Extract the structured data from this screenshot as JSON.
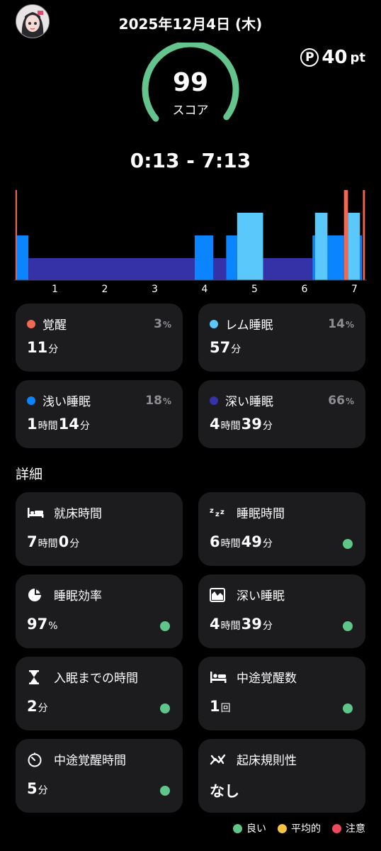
{
  "header": {
    "date": "2025年12月4日 (木)"
  },
  "points": {
    "badge": "P",
    "value": "40",
    "unit": "pt"
  },
  "score": {
    "value": "99",
    "label": "スコア",
    "fraction": 0.99
  },
  "sleep_window": "0:13 - 7:13",
  "colors": {
    "awake": "#ef6a55",
    "rem": "#5ac8fa",
    "light": "#0a84ff",
    "deep": "#3532a7",
    "good": "#5fc68a",
    "avg": "#f6c344",
    "warn": "#ef4a5a",
    "gauge": "#63c48e"
  },
  "hypnogram": {
    "hour_ticks": [
      "1",
      "2",
      "3",
      "4",
      "5",
      "6",
      "7"
    ]
  },
  "chart_data": {
    "type": "area",
    "x_unit": "clock hour",
    "x_ticks": [
      1,
      2,
      3,
      4,
      5,
      6,
      7
    ],
    "levels": [
      "deep",
      "light",
      "rem",
      "awake"
    ],
    "segments": [
      {
        "stage": "awake",
        "start": 0.21,
        "end": 0.24
      },
      {
        "stage": "light",
        "start": 0.24,
        "end": 0.47
      },
      {
        "stage": "deep",
        "start": 0.47,
        "end": 3.8
      },
      {
        "stage": "light",
        "start": 3.8,
        "end": 4.17
      },
      {
        "stage": "deep",
        "start": 4.17,
        "end": 4.43
      },
      {
        "stage": "light",
        "start": 4.43,
        "end": 4.65
      },
      {
        "stage": "rem",
        "start": 4.65,
        "end": 5.17
      },
      {
        "stage": "deep",
        "start": 5.17,
        "end": 6.16
      },
      {
        "stage": "light",
        "start": 6.16,
        "end": 6.21
      },
      {
        "stage": "rem",
        "start": 6.21,
        "end": 6.46
      },
      {
        "stage": "light",
        "start": 6.46,
        "end": 6.79
      },
      {
        "stage": "awake",
        "start": 6.79,
        "end": 6.87
      },
      {
        "stage": "rem",
        "start": 6.87,
        "end": 7.11
      },
      {
        "stage": "light",
        "start": 7.11,
        "end": 7.15
      },
      {
        "stage": "awake",
        "start": 7.17,
        "end": 7.21
      }
    ]
  },
  "stages": [
    {
      "label": "覚醒",
      "pct": "3",
      "pct_unit": "%",
      "value": [
        [
          "11",
          ""
        ],
        [
          "",
          "分"
        ]
      ],
      "color": "#ef6a55"
    },
    {
      "label": "レム睡眠",
      "pct": "14",
      "pct_unit": "%",
      "value": [
        [
          "57",
          ""
        ],
        [
          "",
          "分"
        ]
      ],
      "color": "#5ac8fa"
    },
    {
      "label": "浅い睡眠",
      "pct": "18",
      "pct_unit": "%",
      "value": [
        [
          "1",
          ""
        ],
        [
          "",
          "時間"
        ],
        [
          "14",
          ""
        ],
        [
          "",
          "分"
        ]
      ],
      "color": "#0a84ff"
    },
    {
      "label": "深い睡眠",
      "pct": "66",
      "pct_unit": "%",
      "value": [
        [
          "4",
          ""
        ],
        [
          "",
          "時間"
        ],
        [
          "39",
          ""
        ],
        [
          "",
          "分"
        ]
      ],
      "color": "#3532a7"
    }
  ],
  "details_title": "詳細",
  "details": [
    {
      "icon": "bed-icon",
      "label": "就床時間",
      "value": [
        [
          "7",
          ""
        ],
        [
          "",
          "時間"
        ],
        [
          "0",
          ""
        ],
        [
          "",
          "分"
        ]
      ],
      "status": null
    },
    {
      "icon": "zzz-icon",
      "label": "睡眠時間",
      "value": [
        [
          "6",
          ""
        ],
        [
          "",
          "時間"
        ],
        [
          "49",
          ""
        ],
        [
          "",
          "分"
        ]
      ],
      "status": "good"
    },
    {
      "icon": "pie-icon",
      "label": "睡眠効率",
      "value": [
        [
          "97",
          ""
        ],
        [
          "",
          "%"
        ]
      ],
      "status": "good"
    },
    {
      "icon": "deep-sleep-icon",
      "label": "深い睡眠",
      "value": [
        [
          "4",
          ""
        ],
        [
          "",
          "時間"
        ],
        [
          "39",
          ""
        ],
        [
          "",
          "分"
        ]
      ],
      "status": "good"
    },
    {
      "icon": "hourglass-icon",
      "label": "入眠までの時間",
      "value": [
        [
          "2",
          ""
        ],
        [
          "",
          "分"
        ]
      ],
      "status": "good"
    },
    {
      "icon": "bed-person-icon",
      "label": "中途覚醒数",
      "value": [
        [
          "1",
          ""
        ],
        [
          "",
          "回"
        ]
      ],
      "status": "good"
    },
    {
      "icon": "timer-icon",
      "label": "中途覚醒時間",
      "value": [
        [
          "5",
          ""
        ],
        [
          "",
          "分"
        ]
      ],
      "status": "good"
    },
    {
      "icon": "regularity-icon",
      "label": "起床規則性",
      "value": [
        [
          "なし",
          ""
        ]
      ],
      "status": null
    }
  ],
  "legend": [
    {
      "label": "良い",
      "color": "#5fc68a"
    },
    {
      "label": "平均的",
      "color": "#f6c344"
    },
    {
      "label": "注意",
      "color": "#ef4a5a"
    }
  ]
}
